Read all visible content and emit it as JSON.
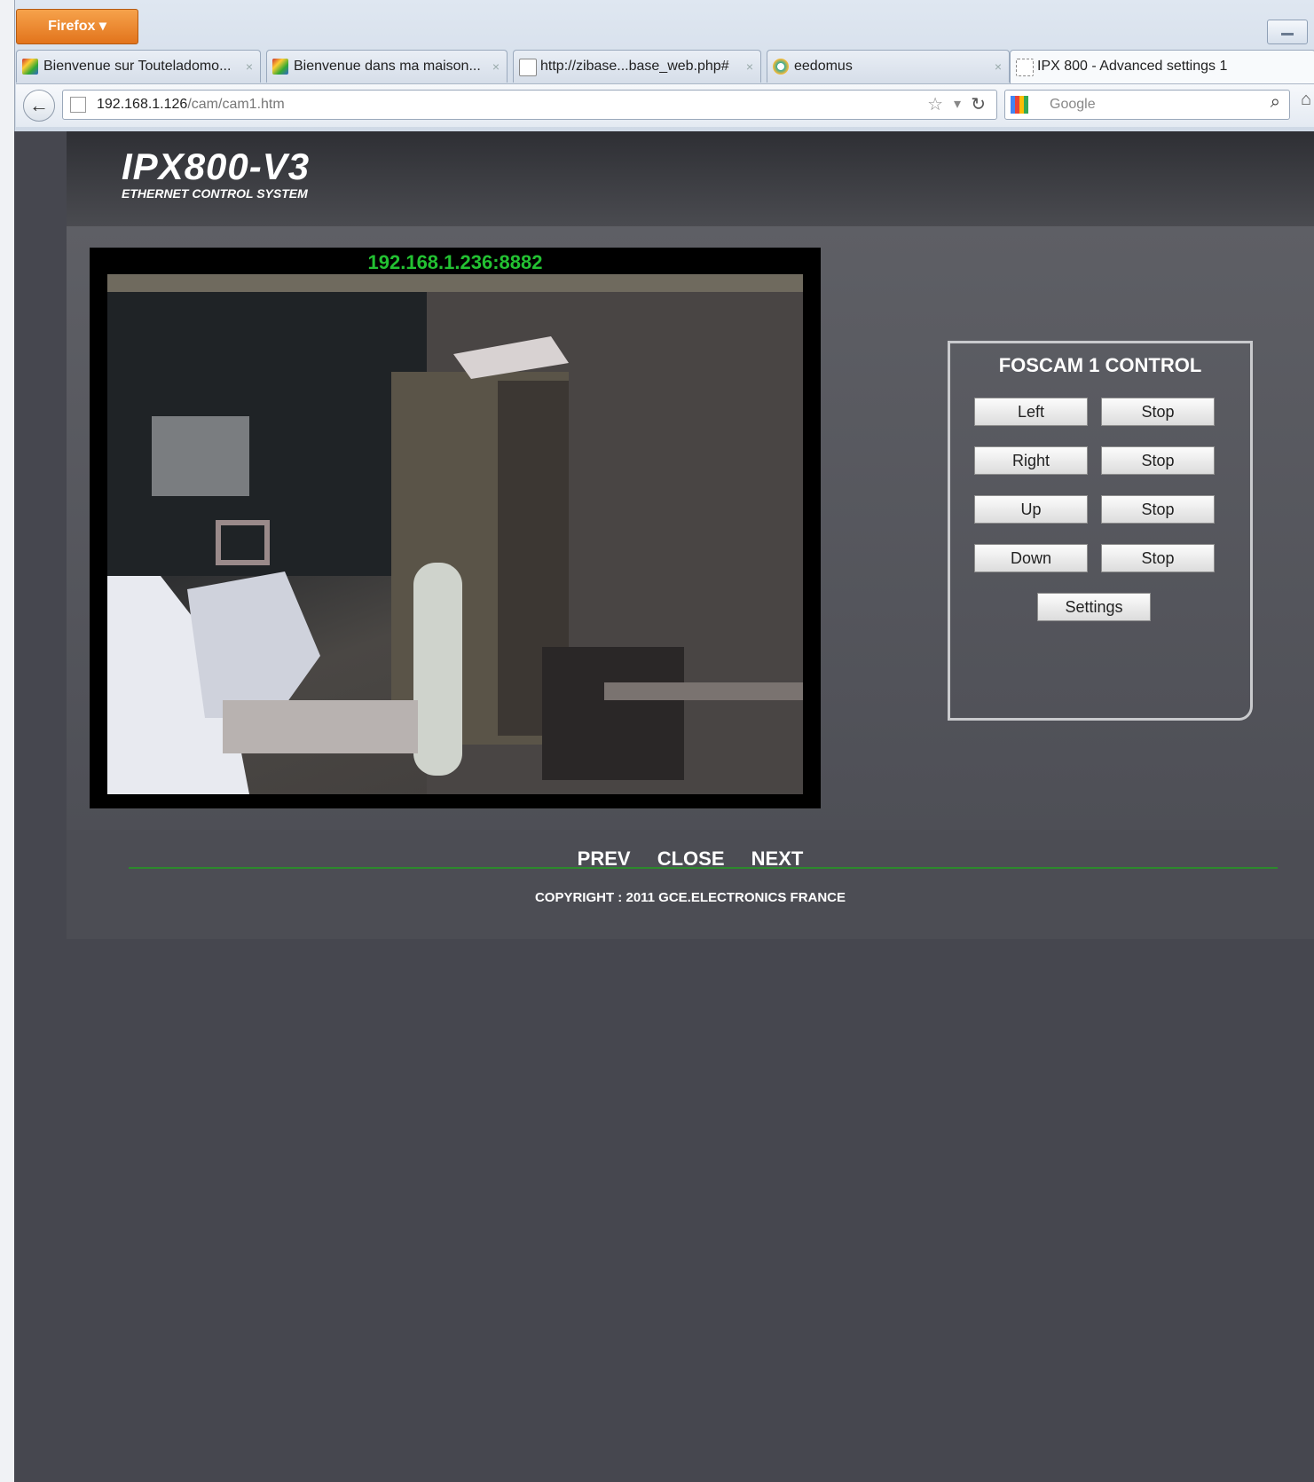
{
  "browser": {
    "menu_button": "Firefox ▾",
    "tabs": [
      {
        "label": "Bienvenue sur Touteladomo...",
        "close": "×"
      },
      {
        "label": "Bienvenue dans ma maison...",
        "close": "×"
      },
      {
        "label": "http://zibase...base_web.php#",
        "close": "×"
      },
      {
        "label": "eedomus",
        "close": "×"
      },
      {
        "label": "IPX 800 - Advanced settings 1",
        "close": ""
      }
    ],
    "url_host": "192.168.1.126",
    "url_path": "/cam/cam1.htm",
    "search_placeholder": "Google"
  },
  "header": {
    "logo": "IPX800-V3",
    "logo_sub": "ETHERNET CONTROL SYSTEM"
  },
  "camera": {
    "address": "192.168.1.236:8882"
  },
  "control": {
    "title": "FOSCAM 1 CONTROL",
    "buttons": {
      "left": "Left",
      "stop1": "Stop",
      "right": "Right",
      "stop2": "Stop",
      "up": "Up",
      "stop3": "Stop",
      "down": "Down",
      "stop4": "Stop",
      "settings": "Settings"
    }
  },
  "footer": {
    "prev": "PREV",
    "close": "CLOSE",
    "next": "NEXT",
    "copyright": "COPYRIGHT : 2011 GCE.ELECTRONICS FRANCE"
  },
  "colors": {
    "camera_label": "#23c132",
    "page_bg": "#46474f",
    "footer_line": "#2d8a2d"
  }
}
